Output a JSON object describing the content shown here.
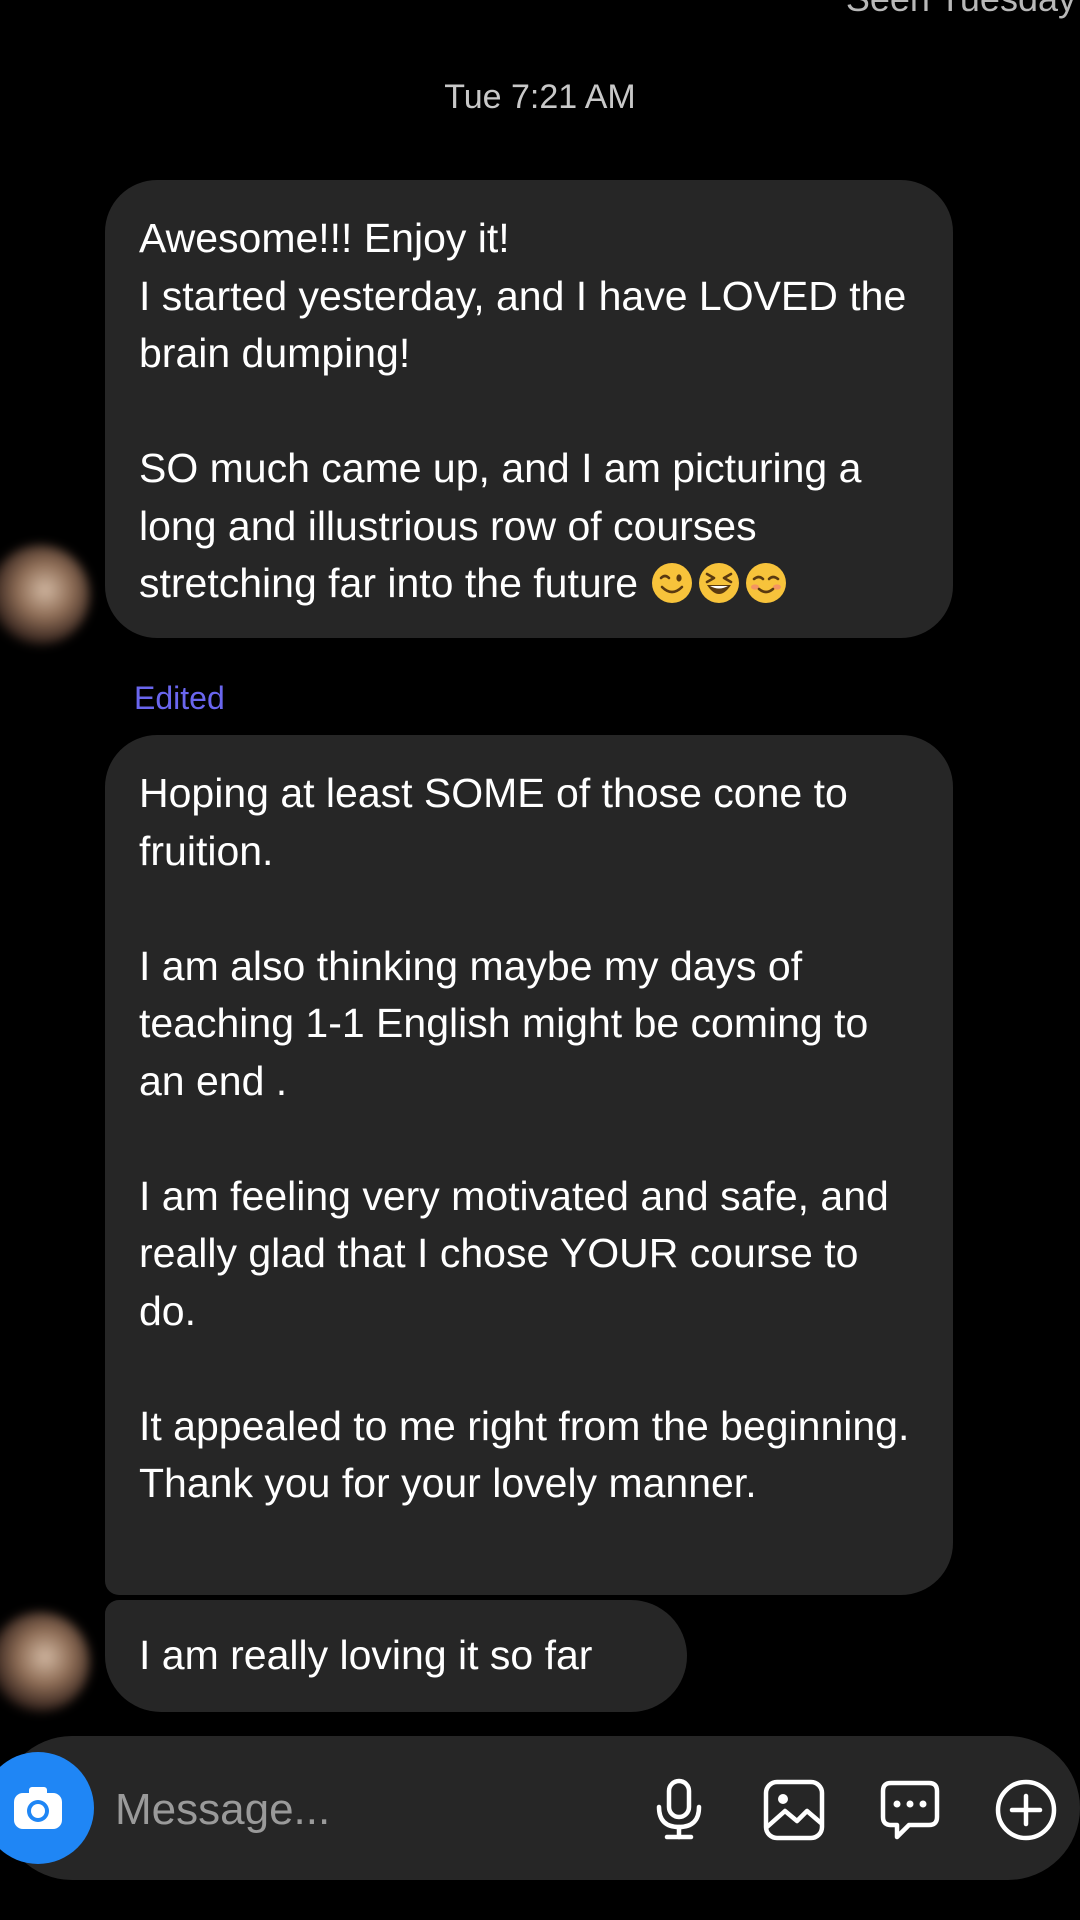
{
  "thread": {
    "seen_status": "Seen Tuesday",
    "timestamp": "Tue 7:21 AM",
    "edited_label": "Edited"
  },
  "messages": [
    {
      "text": "Awesome!!! Enjoy it!\nI started yesterday, and I have LOVED the brain dumping!\n\nSO much came up, and I am picturing a long and illustrious row of courses stretching far into the future",
      "emojis": [
        "winking-face-emoji",
        "grinning-squinting-face-emoji",
        "smiling-face-emoji"
      ]
    },
    {
      "text": "Hoping at least SOME of those cone to fruition.\n\nI am also thinking maybe my days of teaching 1-1 English might be coming to an end .\n\nI am feeling very motivated and safe, and really glad that I chose YOUR course to do.\n\nIt appealed to me right from the beginning.\nThank you for your lovely manner."
    },
    {
      "text": "I am really loving it so far"
    }
  ],
  "composer": {
    "placeholder": "Message...",
    "icons": [
      "camera-icon",
      "microphone-icon",
      "gallery-icon",
      "sticker-icon",
      "plus-icon"
    ]
  },
  "colors": {
    "background": "#000000",
    "bubble": "#262626",
    "edited_label": "#6a66ee",
    "camera_button": "#1f86f5",
    "placeholder": "#9a9a9a",
    "emoji_yellow": "#f7c33b"
  }
}
